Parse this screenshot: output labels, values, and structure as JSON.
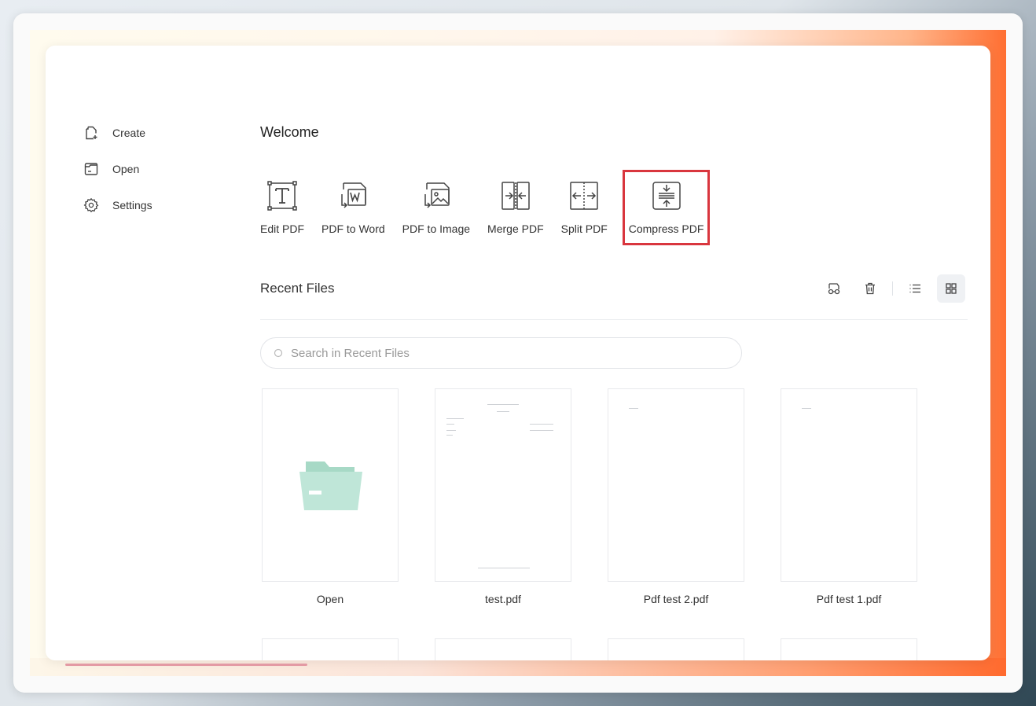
{
  "sidebar": {
    "items": [
      {
        "label": "Create",
        "icon": "create-icon"
      },
      {
        "label": "Open",
        "icon": "open-folder-icon"
      },
      {
        "label": "Settings",
        "icon": "gear-icon"
      }
    ]
  },
  "main": {
    "welcome": "Welcome",
    "tools": [
      {
        "label": "Edit PDF",
        "icon": "edit-pdf-icon"
      },
      {
        "label": "PDF to Word",
        "icon": "pdf-to-word-icon"
      },
      {
        "label": "PDF to Image",
        "icon": "pdf-to-image-icon"
      },
      {
        "label": "Merge PDF",
        "icon": "merge-pdf-icon"
      },
      {
        "label": "Split PDF",
        "icon": "split-pdf-icon"
      },
      {
        "label": "Compress PDF",
        "icon": "compress-pdf-icon",
        "highlighted": true
      }
    ],
    "recent": {
      "title": "Recent Files",
      "search_placeholder": "Search in Recent Files",
      "files": [
        {
          "label": "Open",
          "kind": "open-folder"
        },
        {
          "label": "test.pdf",
          "kind": "pdf"
        },
        {
          "label": "Pdf test 2.pdf",
          "kind": "pdf"
        },
        {
          "label": "Pdf test 1.pdf",
          "kind": "pdf"
        }
      ]
    }
  },
  "colors": {
    "highlight": "#d9363e",
    "folder": "#bfe6d8",
    "accent_gradient": "#ff6f32"
  }
}
